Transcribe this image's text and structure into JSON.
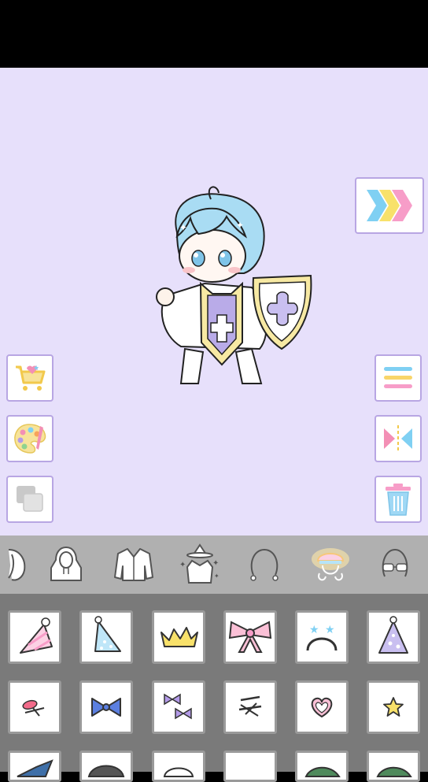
{
  "app": {
    "screen": "dress-up-editor"
  },
  "colors": {
    "stage_bg": "#e7e0fb",
    "button_border": "#b8a6e3",
    "category_bar": "#b0b0b0",
    "items_panel": "#7a7a7a",
    "selected_category_glow": "#ffe9a8"
  },
  "left_tools": [
    {
      "name": "shop-cart-button",
      "icon": "shopping-cart-icon"
    },
    {
      "name": "palette-button",
      "icon": "palette-icon"
    },
    {
      "name": "layers-button",
      "icon": "layers-icon"
    }
  ],
  "right_tools": [
    {
      "name": "menu-button",
      "icon": "hamburger-icon"
    },
    {
      "name": "flip-button",
      "icon": "mirror-flip-icon"
    },
    {
      "name": "delete-button",
      "icon": "trash-icon"
    }
  ],
  "next_button": {
    "icon": "triple-chevron-right-icon"
  },
  "categories": [
    {
      "id": "hair-back",
      "icon": "hair-icon",
      "selected": false
    },
    {
      "id": "hoodie",
      "icon": "hoodie-icon",
      "selected": false
    },
    {
      "id": "jacket",
      "icon": "jacket-icon",
      "selected": false
    },
    {
      "id": "costume",
      "icon": "wizard-costume-icon",
      "selected": false
    },
    {
      "id": "face-outline",
      "icon": "head-outline-icon",
      "selected": false
    },
    {
      "id": "accessory",
      "icon": "hat-accessory-icon",
      "selected": true
    },
    {
      "id": "glasses",
      "icon": "glasses-icon",
      "selected": false
    }
  ],
  "items": [
    {
      "name": "pink-party-hat",
      "icon": "party-hat-icon"
    },
    {
      "name": "blue-party-hat",
      "icon": "party-hat-icon"
    },
    {
      "name": "yellow-crown",
      "icon": "crown-icon"
    },
    {
      "name": "pink-ribbon-bow",
      "icon": "ribbon-icon"
    },
    {
      "name": "star-headband",
      "icon": "star-headband-icon"
    },
    {
      "name": "purple-party-hat",
      "icon": "party-hat-icon"
    },
    {
      "name": "pink-hairpin",
      "icon": "hairpin-icon"
    },
    {
      "name": "blue-bow",
      "icon": "bow-icon"
    },
    {
      "name": "purple-mini-bows",
      "icon": "mini-bows-icon"
    },
    {
      "name": "cross-hairpins",
      "icon": "hairpin-icon"
    },
    {
      "name": "heart-pin",
      "icon": "heart-icon"
    },
    {
      "name": "star-pin",
      "icon": "star-icon"
    }
  ]
}
